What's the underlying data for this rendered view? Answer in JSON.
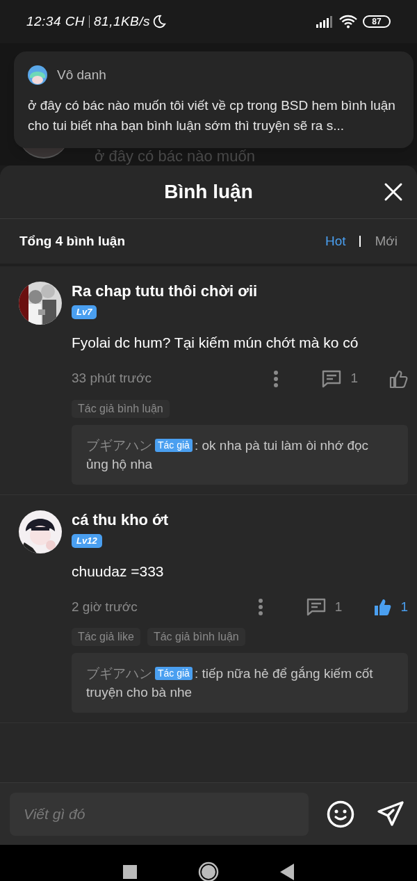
{
  "status_bar": {
    "time": "12:34 CH",
    "speed": "81,1KB/s",
    "battery": "87"
  },
  "background": {
    "text": "ở đây có bác nào muốn"
  },
  "notification": {
    "author": "Vô danh",
    "text": "ở đây có bác nào muốn tôi viết về cp trong BSD hem bình luận cho tui biết nha bạn bình luận sớm thì truyện sẽ ra s..."
  },
  "sheet": {
    "title": "Bình luận",
    "total": "Tổng 4 bình luận",
    "sort_tabs": [
      {
        "label": "Hot",
        "selected": true
      },
      {
        "label": "Mới",
        "selected": false
      }
    ]
  },
  "comments": [
    {
      "name": "Ra chap tutu thôi chời ơii",
      "level": "Lv7",
      "text": "Fyolai dc hum? Tại kiếm mún chớt mà ko có",
      "time": "33 phút trước",
      "reply_count": "1",
      "liked": false,
      "tags": [
        "Tác giả bình luận"
      ],
      "replies": [
        {
          "author": "ブギアハン",
          "badge": "Tác giả",
          "text": ": ok nha pà tui làm òi nhớ đọc ủng hộ nha"
        }
      ]
    },
    {
      "name": "cá thu kho ớt",
      "level": "Lv12",
      "text": "chuudaz =333",
      "time": "2 giờ trước",
      "reply_count": "1",
      "liked": true,
      "like_count": "1",
      "tags": [
        "Tác giả like",
        "Tác giả bình luận"
      ],
      "replies": [
        {
          "author": "ブギアハン",
          "badge": "Tác giả",
          "text": ": tiếp nữa hẻ để gắng kiếm cốt truyện cho bà nhe"
        }
      ]
    }
  ],
  "composer": {
    "placeholder": "Viết gì đó"
  }
}
